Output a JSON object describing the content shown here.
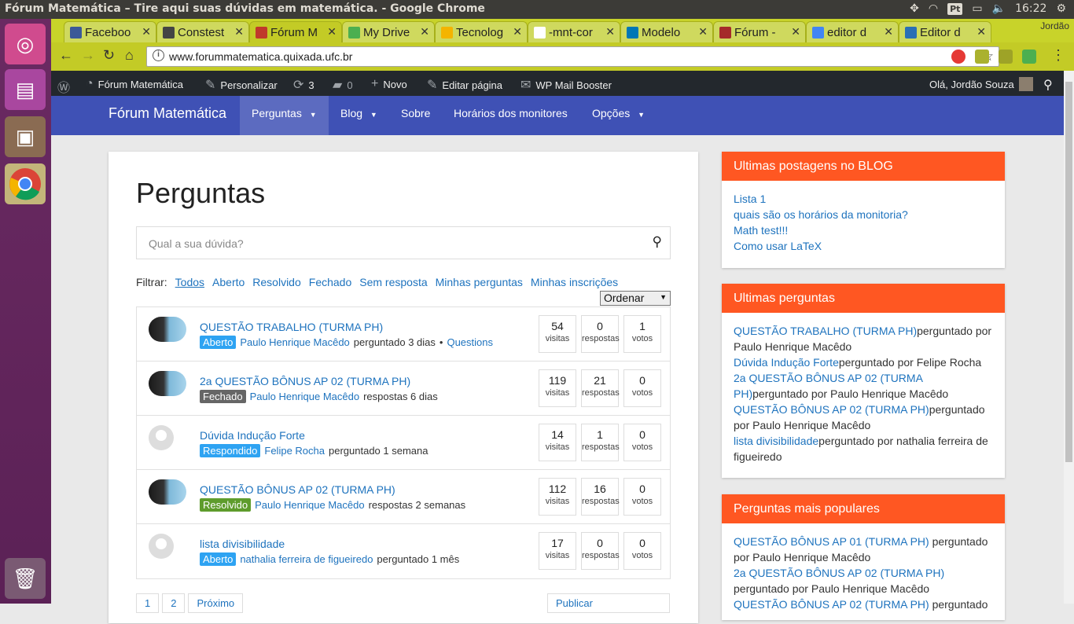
{
  "os": {
    "window_title": "Fórum Matemática – Tire aqui suas dúvidas em matemática. - Google Chrome",
    "keyboard": "Pt",
    "clock": "16:22"
  },
  "browser": {
    "tabs": [
      {
        "label": "Faceboo",
        "color": "#3b5998"
      },
      {
        "label": "Constest",
        "color": "#444444"
      },
      {
        "label": "Fórum M",
        "color": "#c0392b"
      },
      {
        "label": "My Drive",
        "color": "#4caf50"
      },
      {
        "label": "Tecnolog",
        "color": "#f4b400"
      },
      {
        "label": "-mnt-cor",
        "color": "#ffffff"
      },
      {
        "label": "Modelo",
        "color": "#0077b5"
      },
      {
        "label": "Fórum -",
        "color": "#a52a2a"
      },
      {
        "label": "editor d",
        "color": "#4285f4"
      },
      {
        "label": "Editor d",
        "color": "#2a6fb5"
      }
    ],
    "profile_name": "Jordão",
    "url": "www.forummatematica.quixada.ufc.br"
  },
  "adminbar": {
    "site_name": "Fórum Matemática",
    "customize": "Personalizar",
    "updates": "3",
    "comments": "0",
    "new": "Novo",
    "edit_page": "Editar página",
    "mail_booster": "WP Mail Booster",
    "greeting": "Olá, Jordão Souza"
  },
  "sitenav": {
    "brand": "Fórum Matemática",
    "items": [
      "Perguntas",
      "Blog",
      "Sobre",
      "Horários dos monitores",
      "Opções"
    ]
  },
  "main": {
    "title": "Perguntas",
    "search_placeholder": "Qual a sua dúvida?",
    "filter_label": "Filtrar:",
    "filters": [
      "Todos",
      "Aberto",
      "Resolvido",
      "Fechado",
      "Sem resposta",
      "Minhas perguntas",
      "Minhas inscrições"
    ],
    "order_label": "Ordenar",
    "stat_labels": {
      "views": "visitas",
      "answers": "respostas",
      "votes": "votos"
    },
    "questions": [
      {
        "title": "QUESTÃO TRABALHO (TURMA PH)",
        "status": "Aberto",
        "status_color": "#2ea3f2",
        "author": "Paulo Henrique Macêdo",
        "action": "perguntado 3 dias",
        "sep": "•",
        "category": "Questions",
        "views": "54",
        "answers": "0",
        "votes": "1"
      },
      {
        "title": "2a QUESTÃO BÔNUS AP 02 (TURMA PH)",
        "status": "Fechado",
        "status_color": "#666666",
        "author": "Paulo Henrique Macêdo",
        "action": "respostas 6 dias",
        "sep": "",
        "category": "",
        "views": "119",
        "answers": "21",
        "votes": "0"
      },
      {
        "title": "Dúvida Indução Forte",
        "status": "Respondido",
        "status_color": "#2ea3f2",
        "author": "Felipe Rocha",
        "action": "perguntado 1 semana",
        "sep": "",
        "category": "",
        "views": "14",
        "answers": "1",
        "votes": "0"
      },
      {
        "title": "QUESTÃO BÔNUS AP 02 (TURMA PH)",
        "status": "Resolvido",
        "status_color": "#5e9c2c",
        "author": "Paulo Henrique Macêdo",
        "action": "respostas 2 semanas",
        "sep": "",
        "category": "",
        "views": "112",
        "answers": "16",
        "votes": "0"
      },
      {
        "title": "lista divisibilidade",
        "status": "Aberto",
        "status_color": "#2ea3f2",
        "author": "nathalia ferreira de figueiredo",
        "action": "perguntado 1 mês",
        "sep": "",
        "category": "",
        "views": "17",
        "answers": "0",
        "votes": "0"
      }
    ],
    "pager": [
      "1",
      "2",
      "Próximo"
    ],
    "publish": "Publicar"
  },
  "sidebar": {
    "blog": {
      "title": "Ultimas postagens no BLOG",
      "links": [
        "Lista 1",
        "quais são os horários da monitoria?",
        "Math test!!!",
        "Como usar LaTeX"
      ]
    },
    "recent": {
      "title": "Ultimas perguntas",
      "lines": [
        {
          "link": "QUESTÃO TRABALHO (TURMA PH)",
          "text": "perguntado por Paulo Henrique Macêdo"
        },
        {
          "link": "Dúvida Indução Forte",
          "text": "perguntado por Felipe Rocha"
        },
        {
          "link": "2a QUESTÃO BÔNUS AP 02 (TURMA PH)",
          "text": "perguntado por Paulo Henrique Macêdo"
        },
        {
          "link": "QUESTÃO BÔNUS AP 02 (TURMA PH)",
          "text": "perguntado por Paulo Henrique Macêdo"
        },
        {
          "link": "lista divisibilidade",
          "text": "perguntado por nathalia ferreira de figueiredo"
        }
      ]
    },
    "popular": {
      "title": "Perguntas mais populares",
      "lines": [
        {
          "link": "QUESTÃO BÔNUS AP 01 (TURMA PH)",
          "text": " perguntado por Paulo Henrique Macêdo"
        },
        {
          "link": "2a QUESTÃO BÔNUS AP 02 (TURMA PH)",
          "text": " perguntado por Paulo Henrique Macêdo"
        },
        {
          "link": "QUESTÃO BÔNUS AP 02 (TURMA PH)",
          "text": " perguntado"
        }
      ]
    }
  }
}
